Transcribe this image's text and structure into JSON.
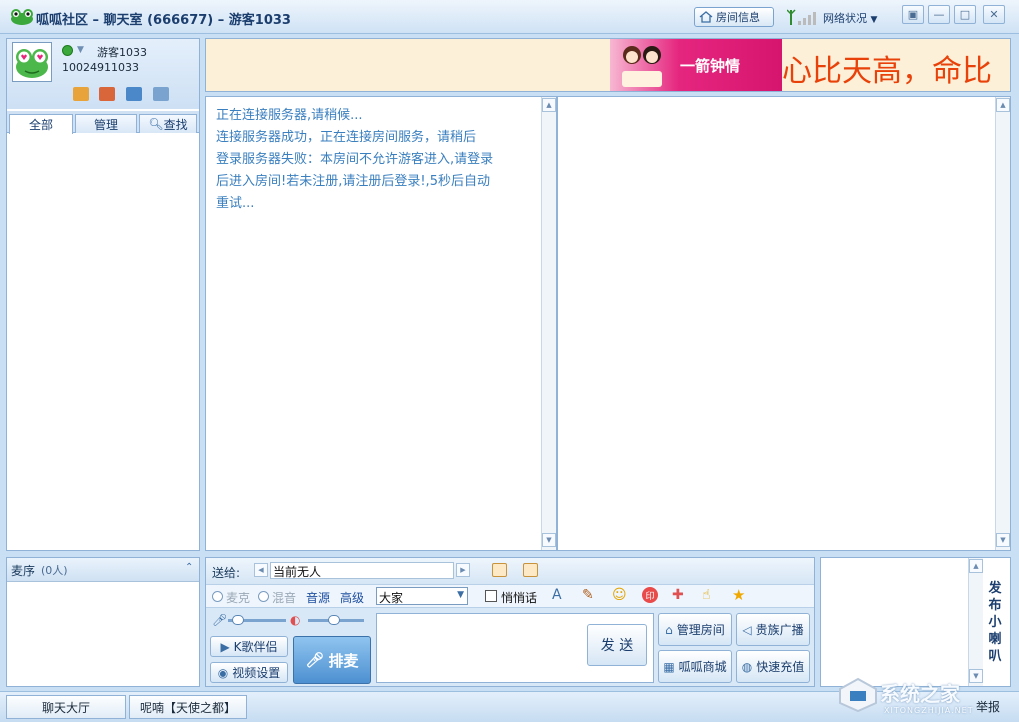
{
  "titlebar": {
    "title": "呱呱社区 – 聊天室 (666677) – 游客1033",
    "room_info": "房间信息",
    "net_status": "网络状况"
  },
  "profile": {
    "nickname": "游客1033",
    "user_id": "10024911033"
  },
  "left_tabs": [
    {
      "label": "全部"
    },
    {
      "label": "管理"
    },
    {
      "label": "查找"
    }
  ],
  "ad": {
    "image_text": "一箭钟情",
    "banner_text": "心比天高，命比"
  },
  "chat": {
    "messages": [
      "正在连接服务器,请稍候...",
      "连接服务器成功，正在连接房间服务，请稍后",
      "登录服务器失败：本房间不允许游客进入,请登录",
      "后进入房间!若未注册,请注册后登录!,5秒后自动",
      "重试..."
    ]
  },
  "mic_queue": {
    "title": "麦序",
    "count": "(0人)"
  },
  "input": {
    "send_to_label": "送给:",
    "send_to_value": "当前无人",
    "mic_label": "麦克",
    "mix_label": "混音",
    "audio_source": "音源",
    "advanced": "高级",
    "audience_value": "大家",
    "whisper_label": "悄悄话",
    "karaoke_btn": "K歌伴侣",
    "video_btn": "视频设置",
    "queue_btn": "排麦",
    "send_btn": "发 送",
    "manage_room": "管理房间",
    "vip_broadcast": "贵族广播",
    "shop": "呱呱商城",
    "recharge": "快速充值"
  },
  "broadcast": {
    "label": "发布小喇叭"
  },
  "statusbar": {
    "tab_hall": "聊天大厅",
    "tab_room": "呢喃【天使之都】",
    "report": "举报"
  },
  "watermark": {
    "text": "系统之家",
    "url": "XITONGZHIJIA.NET"
  },
  "colors": {
    "accent": "#3a7fbf",
    "ad_text": "#e8420a",
    "frame": "#8fb2d6"
  }
}
